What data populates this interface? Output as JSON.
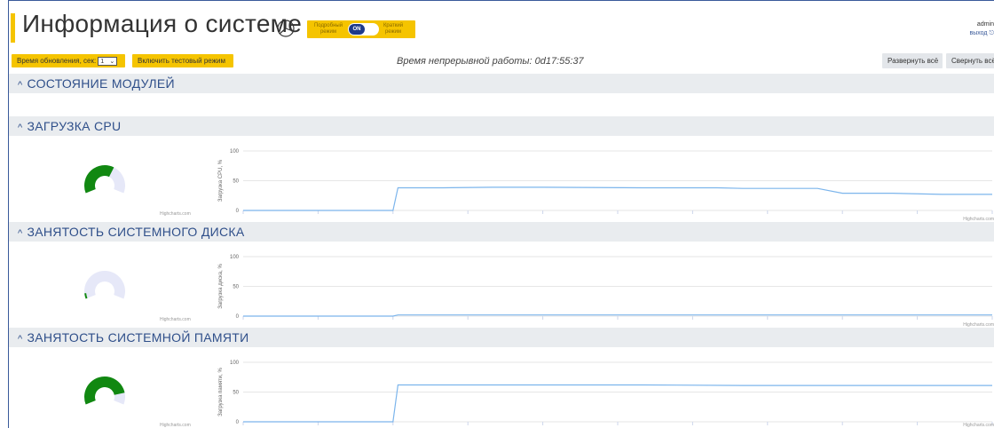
{
  "header": {
    "title": "Информация о системе",
    "mode_left": "Подробный режим",
    "mode_toggle_state": "ON",
    "mode_right": "Краткий режим",
    "user": "admin",
    "logout": "выход"
  },
  "toolbar": {
    "refresh_label": "Время обновления, сек:",
    "refresh_value": "1",
    "test_mode_label": "Включить тестовый режим",
    "uptime": "Время непрерывной работы: 0d17:55:37",
    "expand_all": "Развернуть всё",
    "collapse_all": "Свернуть всё"
  },
  "sections": [
    {
      "title": "СОСТОЯНИЕ МОДУЛЕЙ"
    },
    {
      "title": "ЗАГРУЗКА CPU"
    },
    {
      "title": "ЗАНЯТОСТЬ СИСТЕМНОГО ДИСКА"
    },
    {
      "title": "ЗАНЯТОСТЬ СИСТЕМНОЙ ПАМЯТИ"
    }
  ],
  "credit": "Highcharts.com",
  "colors": {
    "accent": "#f5c400",
    "gauge_fill": "#118811",
    "gauge_track": "#e6e8f8",
    "line": "#7cb5ec",
    "header_bg": "#e9ecef",
    "title_blue": "#2f4f8a"
  },
  "chart_data": [
    {
      "type": "line",
      "ylabel": "Загрузка CPU, %",
      "yticks": [
        "0",
        "50",
        "100"
      ],
      "ylim": [
        0,
        100
      ],
      "gauge_value": 62,
      "x": [
        0,
        30,
        31,
        40,
        50,
        60,
        80,
        95,
        100,
        115,
        120,
        125,
        130,
        140,
        150
      ],
      "y": [
        0,
        0,
        38,
        38,
        39,
        39,
        38,
        38,
        37,
        37,
        29,
        29,
        29,
        27,
        27
      ]
    },
    {
      "type": "line",
      "ylabel": "Загрузка диска, %",
      "yticks": [
        "0",
        "50",
        "100"
      ],
      "ylim": [
        0,
        100
      ],
      "gauge_value": 7,
      "x": [
        0,
        30,
        31,
        150
      ],
      "y": [
        0,
        0,
        2,
        2
      ]
    },
    {
      "type": "line",
      "ylabel": "Загрузка памяти, %",
      "yticks": [
        "0",
        "50",
        "100"
      ],
      "ylim": [
        0,
        100
      ],
      "gauge_value": 85,
      "x": [
        0,
        30,
        31,
        80,
        100,
        150
      ],
      "y": [
        0,
        0,
        62,
        62,
        61,
        61
      ]
    }
  ]
}
